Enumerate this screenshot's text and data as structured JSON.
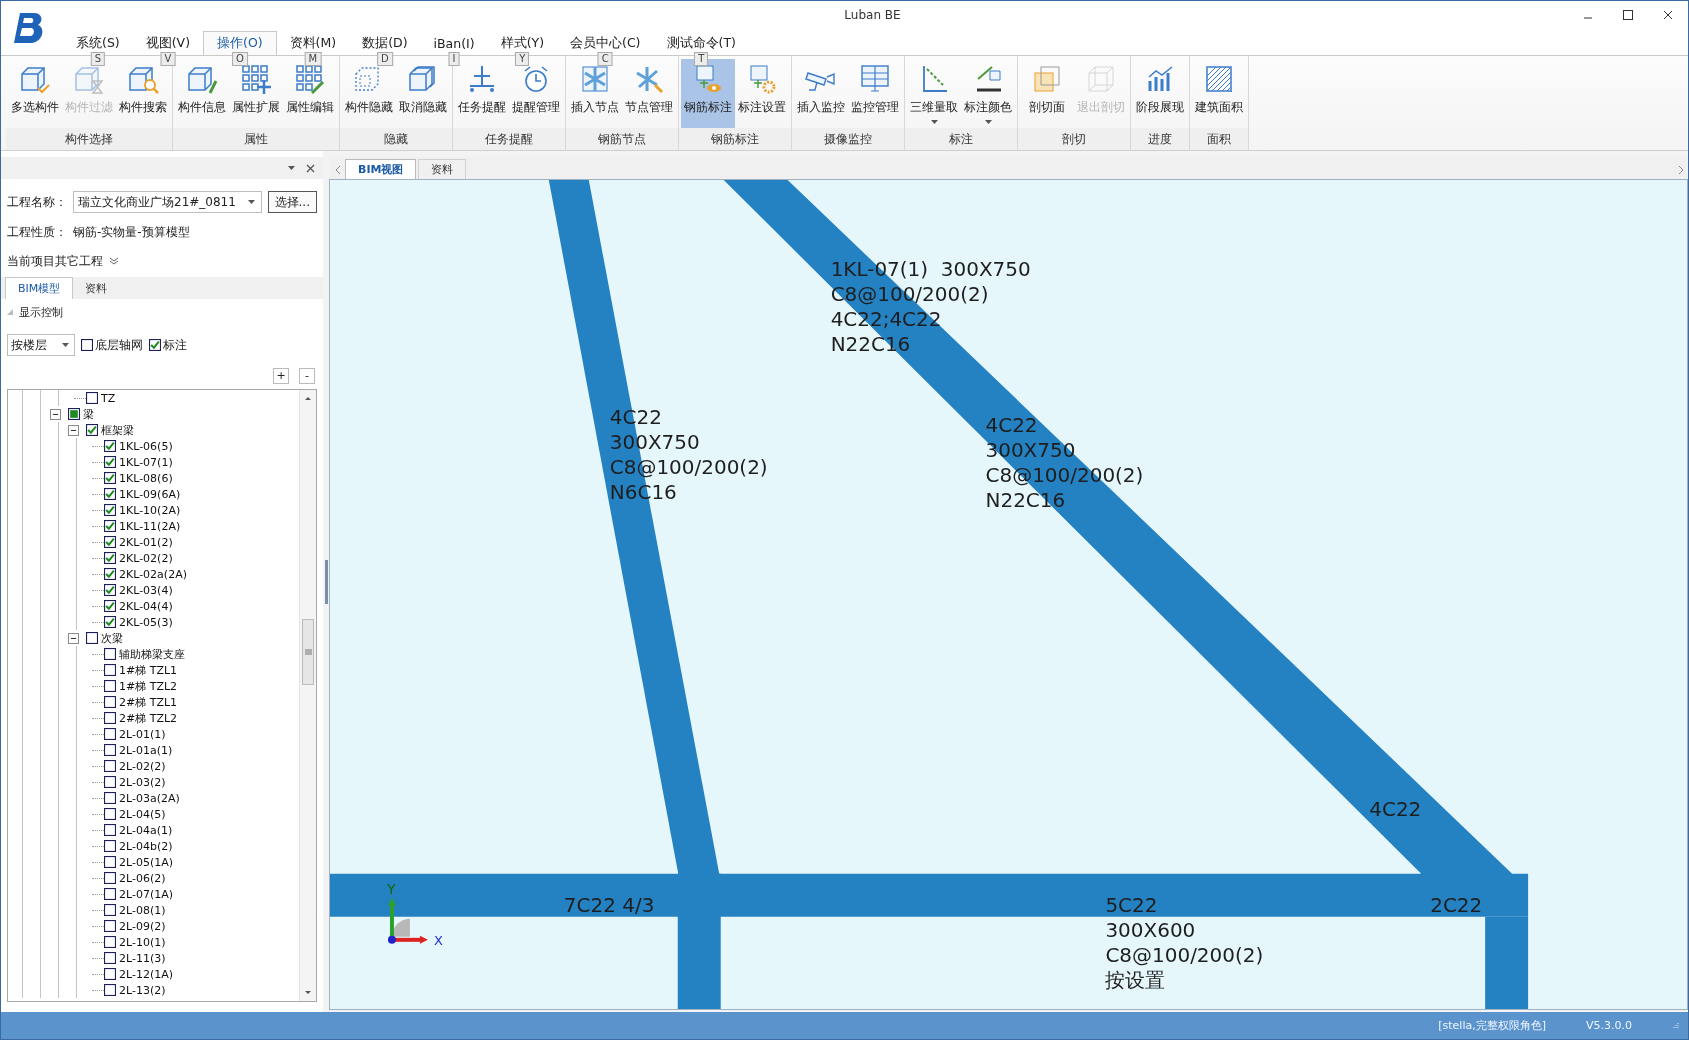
{
  "window": {
    "title": "Luban BE"
  },
  "menu_tabs": [
    {
      "label": "系统(S)",
      "key": "S",
      "selected": false
    },
    {
      "label": "视图(V)",
      "key": "V",
      "selected": false
    },
    {
      "label": "操作(O)",
      "key": "O",
      "selected": true
    },
    {
      "label": "资料(M)",
      "key": "M",
      "selected": false
    },
    {
      "label": "数据(D)",
      "key": "D",
      "selected": false
    },
    {
      "label": "iBan(I)",
      "key": "I",
      "selected": false
    },
    {
      "label": "样式(Y)",
      "key": "Y",
      "selected": false
    },
    {
      "label": "会员中心(C)",
      "key": "C",
      "selected": false
    },
    {
      "label": "测试命令(T)",
      "key": "T",
      "selected": false
    }
  ],
  "ribbon_groups": [
    {
      "label": "构件选择",
      "buttons": [
        {
          "label": "多选构件",
          "kind": "plain",
          "disabled": false,
          "selected": false
        },
        {
          "label": "构件过滤",
          "kind": "plain",
          "disabled": true,
          "selected": false
        },
        {
          "label": "构件搜索",
          "kind": "plain",
          "disabled": false,
          "selected": false
        }
      ]
    },
    {
      "label": "属性",
      "buttons": [
        {
          "label": "构件信息",
          "kind": "plain",
          "disabled": false,
          "selected": false
        },
        {
          "label": "属性扩展",
          "kind": "plain",
          "disabled": false,
          "selected": false
        },
        {
          "label": "属性编辑",
          "kind": "plain",
          "disabled": false,
          "selected": false
        }
      ]
    },
    {
      "label": "隐藏",
      "buttons": [
        {
          "label": "构件隐藏",
          "kind": "plain",
          "disabled": false,
          "selected": false
        },
        {
          "label": "取消隐藏",
          "kind": "plain",
          "disabled": false,
          "selected": false
        }
      ]
    },
    {
      "label": "任务提醒",
      "buttons": [
        {
          "label": "任务提醒",
          "kind": "plain",
          "disabled": false,
          "selected": false
        },
        {
          "label": "提醒管理",
          "kind": "plain",
          "disabled": false,
          "selected": false
        }
      ]
    },
    {
      "label": "钢筋节点",
      "buttons": [
        {
          "label": "插入节点",
          "kind": "plain",
          "disabled": false,
          "selected": false
        },
        {
          "label": "节点管理",
          "kind": "plain",
          "disabled": false,
          "selected": false
        }
      ]
    },
    {
      "label": "钢筋标注",
      "buttons": [
        {
          "label": "钢筋标注",
          "kind": "plain",
          "disabled": false,
          "selected": true
        },
        {
          "label": "标注设置",
          "kind": "plain",
          "disabled": false,
          "selected": false
        }
      ]
    },
    {
      "label": "摄像监控",
      "buttons": [
        {
          "label": "插入监控",
          "kind": "plain",
          "disabled": false,
          "selected": false
        },
        {
          "label": "监控管理",
          "kind": "plain",
          "disabled": false,
          "selected": false
        }
      ]
    },
    {
      "label": "标注",
      "buttons": [
        {
          "label": "三维量取",
          "kind": "split",
          "disabled": false,
          "selected": false
        },
        {
          "label": "标注颜色",
          "kind": "split",
          "disabled": false,
          "selected": false
        }
      ]
    },
    {
      "label": "剖切",
      "buttons": [
        {
          "label": "剖切面",
          "kind": "plain",
          "disabled": false,
          "selected": false
        },
        {
          "label": "退出剖切",
          "kind": "plain",
          "disabled": true,
          "selected": false
        }
      ]
    },
    {
      "label": "进度",
      "buttons": [
        {
          "label": "阶段展现",
          "kind": "plain",
          "disabled": false,
          "selected": false
        }
      ]
    },
    {
      "label": "面积",
      "buttons": [
        {
          "label": "建筑面积",
          "kind": "plain",
          "disabled": false,
          "selected": false
        }
      ]
    }
  ],
  "left_panel": {
    "project_name_label": "工程名称：",
    "project_name": "瑞立文化商业广场21#_0811",
    "choose_button": "选择...",
    "project_type_label": "工程性质：",
    "project_type": "钢筋-实物量-预算模型",
    "other_projects": "当前项目其它工程",
    "tabs": [
      {
        "label": "BIM模型",
        "selected": true
      },
      {
        "label": "资料",
        "selected": false
      }
    ],
    "section": "显示控制",
    "floor_select": "按楼层",
    "options": [
      {
        "label": "底层轴网",
        "checked": false
      },
      {
        "label": "标注",
        "checked": true
      }
    ],
    "expand_all": "+",
    "collapse_all": "-",
    "tree": {
      "above": [
        {
          "label": "TZ",
          "checked": false,
          "partial": false
        }
      ],
      "nodes": [
        {
          "label": "梁",
          "checked": false,
          "partial": true,
          "expanded": true,
          "children": [
            {
              "label": "框架梁",
              "checked": true,
              "partial": false,
              "expanded": true,
              "children": [
                {
                  "label": "1KL-06(5)",
                  "checked": true,
                  "partial": false
                },
                {
                  "label": "1KL-07(1)",
                  "checked": true,
                  "partial": false
                },
                {
                  "label": "1KL-08(6)",
                  "checked": true,
                  "partial": false
                },
                {
                  "label": "1KL-09(6A)",
                  "checked": true,
                  "partial": false
                },
                {
                  "label": "1KL-10(2A)",
                  "checked": true,
                  "partial": false
                },
                {
                  "label": "1KL-11(2A)",
                  "checked": true,
                  "partial": false
                },
                {
                  "label": "2KL-01(2)",
                  "checked": true,
                  "partial": false
                },
                {
                  "label": "2KL-02(2)",
                  "checked": true,
                  "partial": false
                },
                {
                  "label": "2KL-02a(2A)",
                  "checked": true,
                  "partial": false
                },
                {
                  "label": "2KL-03(4)",
                  "checked": true,
                  "partial": false
                },
                {
                  "label": "2KL-04(4)",
                  "checked": true,
                  "partial": false
                },
                {
                  "label": "2KL-05(3)",
                  "checked": true,
                  "partial": false
                }
              ]
            },
            {
              "label": "次梁",
              "checked": false,
              "partial": false,
              "expanded": true,
              "children": [
                {
                  "label": "辅助梯梁支座",
                  "checked": false,
                  "partial": false
                },
                {
                  "label": "1#梯 TZL1",
                  "checked": false,
                  "partial": false
                },
                {
                  "label": "1#梯 TZL2",
                  "checked": false,
                  "partial": false
                },
                {
                  "label": "2#梯 TZL1",
                  "checked": false,
                  "partial": false
                },
                {
                  "label": "2#梯 TZL2",
                  "checked": false,
                  "partial": false
                },
                {
                  "label": "2L-01(1)",
                  "checked": false,
                  "partial": false
                },
                {
                  "label": "2L-01a(1)",
                  "checked": false,
                  "partial": false
                },
                {
                  "label": "2L-02(2)",
                  "checked": false,
                  "partial": false
                },
                {
                  "label": "2L-03(2)",
                  "checked": false,
                  "partial": false
                },
                {
                  "label": "2L-03a(2A)",
                  "checked": false,
                  "partial": false
                },
                {
                  "label": "2L-04(5)",
                  "checked": false,
                  "partial": false
                },
                {
                  "label": "2L-04a(1)",
                  "checked": false,
                  "partial": false
                },
                {
                  "label": "2L-04b(2)",
                  "checked": false,
                  "partial": false
                },
                {
                  "label": "2L-05(1A)",
                  "checked": false,
                  "partial": false
                },
                {
                  "label": "2L-06(2)",
                  "checked": false,
                  "partial": false
                },
                {
                  "label": "2L-07(1A)",
                  "checked": false,
                  "partial": false
                },
                {
                  "label": "2L-08(1)",
                  "checked": false,
                  "partial": false
                },
                {
                  "label": "2L-09(2)",
                  "checked": false,
                  "partial": false
                },
                {
                  "label": "2L-10(1)",
                  "checked": false,
                  "partial": false
                },
                {
                  "label": "2L-11(3)",
                  "checked": false,
                  "partial": false
                },
                {
                  "label": "2L-12(1A)",
                  "checked": false,
                  "partial": false
                },
                {
                  "label": "2L-13(2)",
                  "checked": false,
                  "partial": false
                }
              ]
            }
          ]
        }
      ]
    }
  },
  "doc_tabs": [
    {
      "label": "BIM视图",
      "selected": true
    },
    {
      "label": "资料",
      "selected": false
    }
  ],
  "drawing": {
    "annotations": [
      {
        "lines": [
          "1KL-07(1)  300X750",
          "C8@100/200(2)",
          "4C22;4C22",
          "N22C16"
        ]
      },
      {
        "lines": [
          "4C22",
          "300X750",
          "C8@100/200(2)",
          "N6C16"
        ]
      },
      {
        "lines": [
          "4C22",
          "300X750",
          "C8@100/200(2)",
          "N22C16"
        ]
      },
      {
        "lines": [
          "4C22"
        ]
      },
      {
        "lines": [
          "7C22 4/3"
        ]
      },
      {
        "lines": [
          "5C22",
          "300X600",
          "C8@100/200(2)",
          "按设置"
        ]
      },
      {
        "lines": [
          "2C22"
        ]
      }
    ],
    "axis_labels": {
      "x": "X",
      "y": "Y"
    }
  },
  "status_bar": {
    "user": "[stella,完整权限角色]",
    "version": "V5.3.0.0"
  }
}
